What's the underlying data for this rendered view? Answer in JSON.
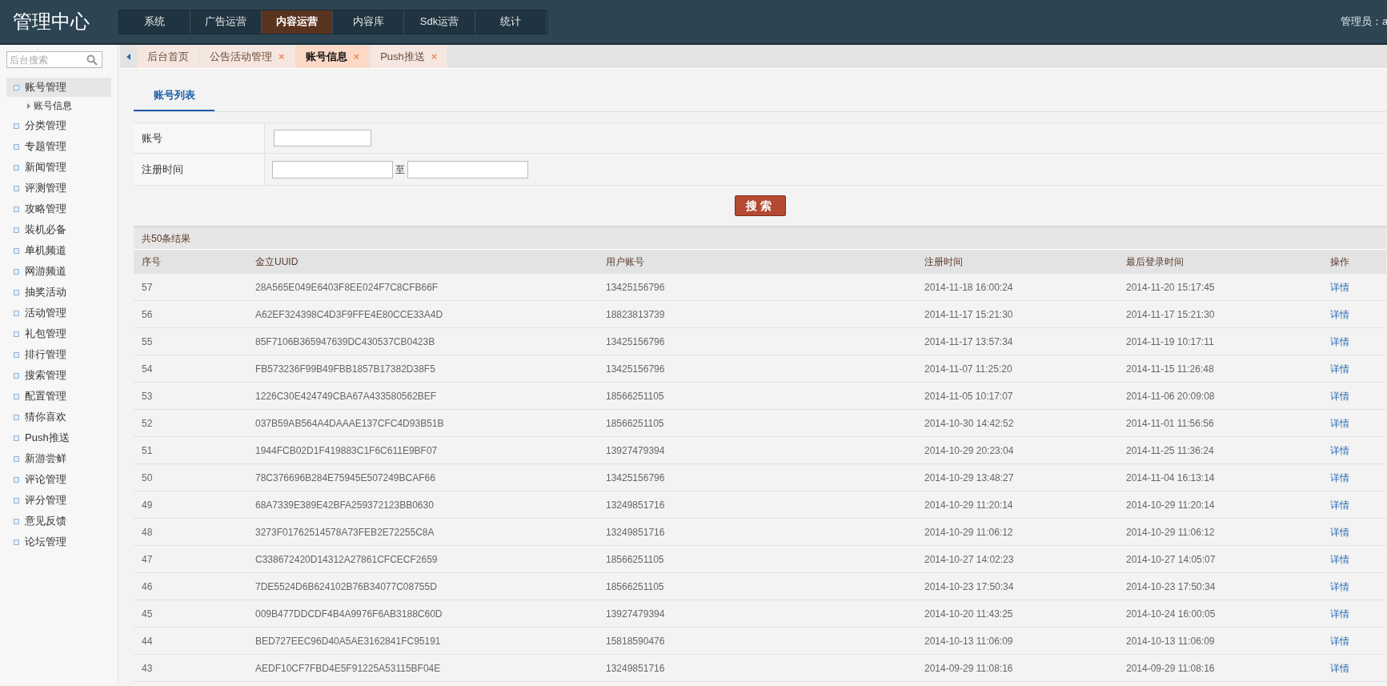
{
  "header": {
    "title": "管理中心",
    "admin": "管理员：a"
  },
  "nav": [
    {
      "label": "系统",
      "selected": false
    },
    {
      "label": "广告运营",
      "selected": false
    },
    {
      "label": "内容运营",
      "selected": true
    },
    {
      "label": "内容库",
      "selected": false
    },
    {
      "label": "Sdk运营",
      "selected": false
    },
    {
      "label": "统计",
      "selected": false
    }
  ],
  "sidebar": {
    "search": {
      "placeholder": "后台搜索"
    },
    "items": [
      {
        "label": "账号管理",
        "selected": true,
        "children": [
          {
            "label": "账号信息"
          }
        ]
      },
      {
        "label": "分类管理",
        "selected": false
      },
      {
        "label": "专题管理",
        "selected": false
      },
      {
        "label": "新闻管理",
        "selected": false
      },
      {
        "label": "评测管理",
        "selected": false
      },
      {
        "label": "攻略管理",
        "selected": false
      },
      {
        "label": "装机必备",
        "selected": false
      },
      {
        "label": "单机频道",
        "selected": false
      },
      {
        "label": "网游频道",
        "selected": false
      },
      {
        "label": "抽奖活动",
        "selected": false
      },
      {
        "label": "活动管理",
        "selected": false
      },
      {
        "label": "礼包管理",
        "selected": false
      },
      {
        "label": "排行管理",
        "selected": false
      },
      {
        "label": "搜索管理",
        "selected": false
      },
      {
        "label": "配置管理",
        "selected": false
      },
      {
        "label": "猜你喜欢",
        "selected": false
      },
      {
        "label": "Push推送",
        "selected": false
      },
      {
        "label": "新游尝鲜",
        "selected": false
      },
      {
        "label": "评论管理",
        "selected": false
      },
      {
        "label": "评分管理",
        "selected": false
      },
      {
        "label": "意见反馈",
        "selected": false
      },
      {
        "label": "论坛管理",
        "selected": false
      }
    ]
  },
  "tabs": [
    {
      "label": "后台首页",
      "selected": false
    },
    {
      "label": "公告活动管理",
      "selected": false,
      "close": "×"
    },
    {
      "label": "账号信息",
      "selected": true,
      "close": "×"
    },
    {
      "label": "Push推送",
      "selected": false,
      "close": "×"
    }
  ],
  "subtabs": [
    {
      "label": "账号列表",
      "selected": true
    }
  ],
  "form": {
    "account_label": "账号",
    "date_label": "注册时间",
    "range_separator": "至",
    "search_button": "搜索"
  },
  "results": {
    "summary": "共50条结果",
    "columns": [
      "序号",
      "金立UUID",
      "用户账号",
      "注册时间",
      "最后登录时间",
      "操作"
    ],
    "rows": [
      [
        "57",
        "28A565E049E6403F8EE024F7C8CFB66F",
        "13425156796",
        "2014-11-18 16:00:24",
        "2014-11-20 15:17:45",
        "详情"
      ],
      [
        "56",
        "A62EF324398C4D3F9FFE4E80CCE33A4D",
        "18823813739",
        "2014-11-17 15:21:30",
        "2014-11-17 15:21:30",
        "详情"
      ],
      [
        "55",
        "85F7106B365947639DC430537CB0423B",
        "13425156796",
        "2014-11-17 13:57:34",
        "2014-11-19 10:17:11",
        "详情"
      ],
      [
        "54",
        "FB573236F99B49FBB1857B17382D38F5",
        "13425156796",
        "2014-11-07 11:25:20",
        "2014-11-15 11:26:48",
        "详情"
      ],
      [
        "53",
        "1226C30E424749CBA67A433580562BEF",
        "18566251105",
        "2014-11-05 10:17:07",
        "2014-11-06 20:09:08",
        "详情"
      ],
      [
        "52",
        "037B59AB564A4DAAAE137CFC4D93B51B",
        "18566251105",
        "2014-10-30 14:42:52",
        "2014-11-01 11:56:56",
        "详情"
      ],
      [
        "51",
        "1944FCB02D1F419883C1F6C611E9BF07",
        "13927479394",
        "2014-10-29 20:23:04",
        "2014-11-25 11:36:24",
        "详情"
      ],
      [
        "50",
        "78C376696B284E75945E507249BCAF66",
        "13425156796",
        "2014-10-29 13:48:27",
        "2014-11-04 16:13:14",
        "详情"
      ],
      [
        "49",
        "68A7339E389E42BFA259372123BB0630",
        "13249851716",
        "2014-10-29 11:20:14",
        "2014-10-29 11:20:14",
        "详情"
      ],
      [
        "48",
        "3273F01762514578A73FEB2E72255C8A",
        "13249851716",
        "2014-10-29 11:06:12",
        "2014-10-29 11:06:12",
        "详情"
      ],
      [
        "47",
        "C338672420D14312A27861CFCECF2659",
        "18566251105",
        "2014-10-27 14:02:23",
        "2014-10-27 14:05:07",
        "详情"
      ],
      [
        "46",
        "7DE5524D6B624102B76B34077C08755D",
        "18566251105",
        "2014-10-23 17:50:34",
        "2014-10-23 17:50:34",
        "详情"
      ],
      [
        "45",
        "009B477DDCDF4B4A9976F6AB3188C60D",
        "13927479394",
        "2014-10-20 11:43:25",
        "2014-10-24 16:00:05",
        "详情"
      ],
      [
        "44",
        "BED727EEC96D40A5AE3162841FC95191",
        "15818590476",
        "2014-10-13 11:06:09",
        "2014-10-13 11:06:09",
        "详情"
      ],
      [
        "43",
        "AEDF10CF7FBD4E5F91225A53115BF04E",
        "13249851716",
        "2014-09-29 11:08:16",
        "2014-09-29 11:08:16",
        "详情"
      ]
    ]
  }
}
